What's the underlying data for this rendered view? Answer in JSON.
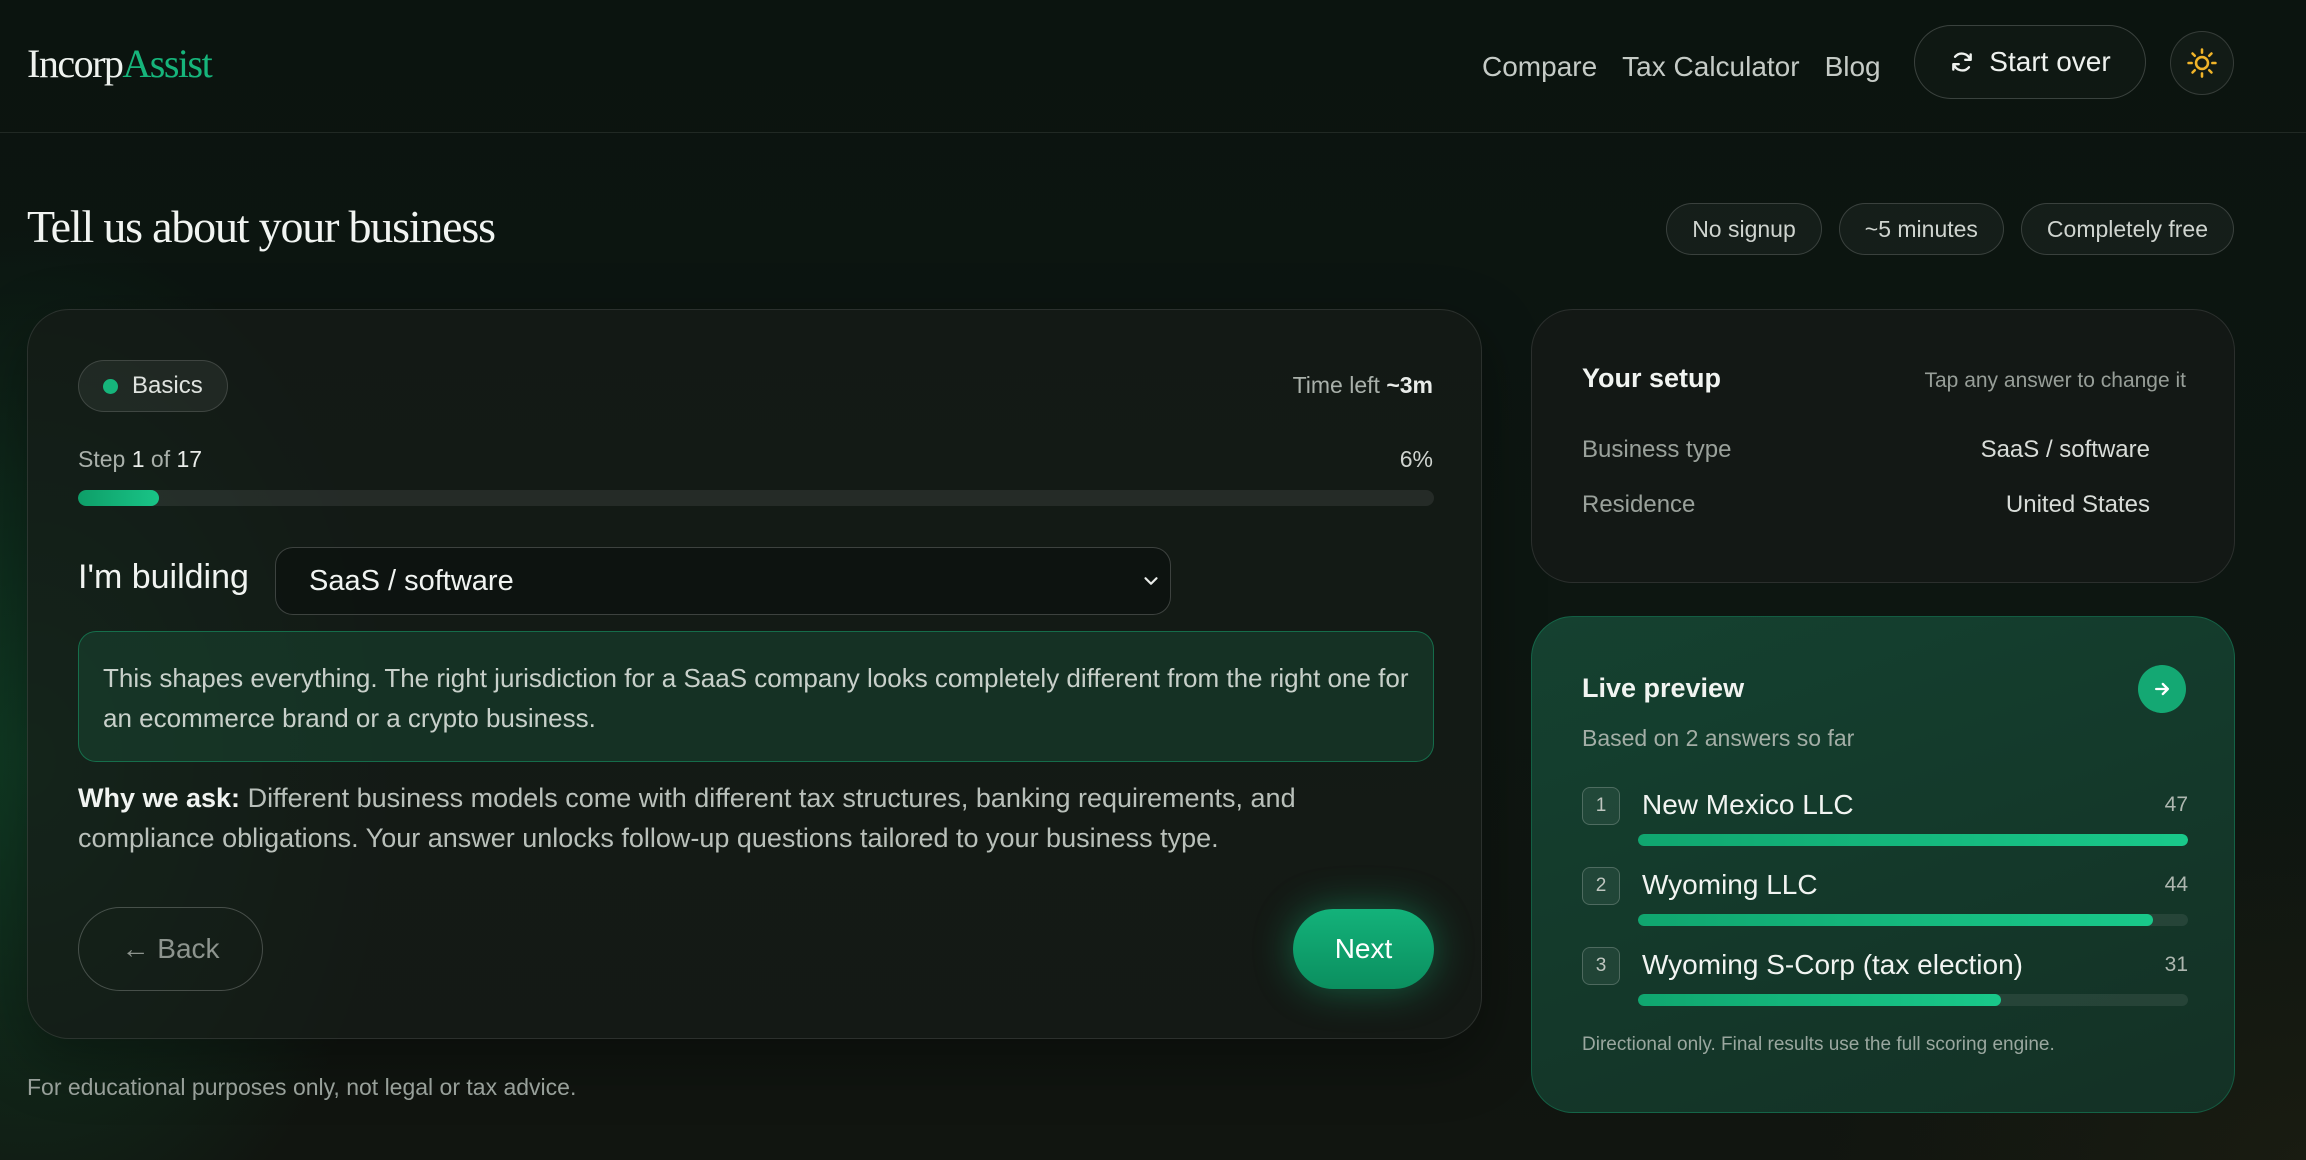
{
  "header": {
    "logo_primary": "Incorp",
    "logo_accent": "Assist",
    "nav": [
      {
        "label": "Compare"
      },
      {
        "label": "Tax Calculator"
      },
      {
        "label": "Blog"
      }
    ],
    "start_over_label": "Start over",
    "icons": {
      "start_over": "refresh-icon",
      "theme": "sun-icon"
    }
  },
  "page": {
    "title": "Tell us about your business",
    "chips": [
      "No signup",
      "~5 minutes",
      "Completely free"
    ],
    "disclaimer": "For educational purposes only, not legal or tax advice."
  },
  "colors": {
    "accent": "#16b57b",
    "sun": "#f0b429"
  },
  "wizard": {
    "section": "Basics",
    "time_left_label": "Time left",
    "time_left_value": "~3m",
    "step_label": "Step",
    "step_current": "1",
    "step_of": "of",
    "step_total": "17",
    "progress_label": "6%",
    "progress_value": 0.06,
    "question_label": "I'm building",
    "selected_option": "SaaS / software",
    "info_text": "This shapes everything. The right jurisdiction for a SaaS company looks completely different from the right one for an ecommerce brand or a crypto business.",
    "why_label": "Why we ask:",
    "why_text": " Different business models come with different tax structures, banking requirements, and compliance obligations. Your answer unlocks follow-up questions tailored to your business type.",
    "back_label": "← Back",
    "next_label": "Next"
  },
  "setup": {
    "title": "Your setup",
    "hint": "Tap any answer to change it",
    "rows": [
      {
        "key": "Business type",
        "value": "SaaS / software"
      },
      {
        "key": "Residence",
        "value": "United States"
      }
    ]
  },
  "preview": {
    "title": "Live preview",
    "subtitle": "Based on 2 answers so far",
    "results": [
      {
        "rank": "1",
        "name": "New Mexico LLC",
        "score": 47,
        "fill": 1.0
      },
      {
        "rank": "2",
        "name": "Wyoming LLC",
        "score": 44,
        "fill": 0.936
      },
      {
        "rank": "3",
        "name": "Wyoming S-Corp (tax election)",
        "score": 31,
        "fill": 0.66
      }
    ],
    "footnote": "Directional only. Final results use the full scoring engine."
  }
}
